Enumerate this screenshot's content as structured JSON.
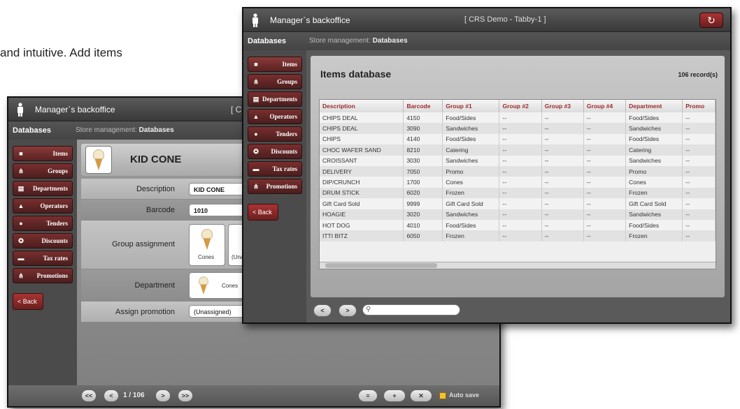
{
  "intro": {
    "text": "and intuitive.  Add items"
  },
  "app": {
    "title": "Manager`s backoffice",
    "section_label": "Databases",
    "breadcrumb_prefix": "Store management:",
    "breadcrumb_current": "Databases"
  },
  "sidebar": {
    "items": [
      {
        "label": "Items",
        "icon": "square-icon"
      },
      {
        "label": "Groups",
        "icon": "groups-icon"
      },
      {
        "label": "Departments",
        "icon": "departments-icon"
      },
      {
        "label": "Operators",
        "icon": "operator-icon"
      },
      {
        "label": "Tenders",
        "icon": "tender-icon"
      },
      {
        "label": "Discounts",
        "icon": "discount-icon"
      },
      {
        "label": "Tax rates",
        "icon": "tax-icon"
      },
      {
        "label": "Promotions",
        "icon": "promotions-icon"
      }
    ],
    "back_label": "< Back"
  },
  "back_window": {
    "title_clip": "[ C",
    "item_name": "KID CONE",
    "form": {
      "description_label": "Description",
      "description_value": "KID CONE",
      "barcode_label": "Barcode",
      "barcode_value": "1010",
      "group_label": "Group assignment",
      "group_card_1": "Cones",
      "group_card_2": "(Unass",
      "department_label": "Department",
      "department_value": "Cones",
      "promotion_label": "Assign promotion",
      "promotion_value": "(Unassigned)"
    },
    "pager": {
      "first": "<<",
      "prev": "<",
      "status": "1 / 106",
      "next": ">",
      "last": ">>",
      "menu": "≡",
      "add": "+",
      "delete": "✕",
      "autosave_label": "Auto save"
    }
  },
  "front_window": {
    "session": "[ CRS Demo  -  Tabby-1 ]",
    "reload_icon": "↻",
    "panel_title": "Items database",
    "record_count": "106 record(s)",
    "columns": [
      "Description",
      "Barcode",
      "Group #1",
      "Group #2",
      "Group #3",
      "Group #4",
      "Department",
      "Promo"
    ],
    "rows": [
      [
        "CHIPS DEAL",
        "4150",
        "Food/Sides",
        "--",
        "--",
        "--",
        "Food/Sides",
        "--"
      ],
      [
        "CHIPS DEAL",
        "3090",
        "Sandwiches",
        "--",
        "--",
        "--",
        "Sandwiches",
        "--"
      ],
      [
        "CHIPS",
        "4140",
        "Food/Sides",
        "--",
        "--",
        "--",
        "Food/Sides",
        "--"
      ],
      [
        "CHOC WAFER SAND",
        "8210",
        "Catering",
        "--",
        "--",
        "--",
        "Catering",
        "--"
      ],
      [
        "CROISSANT",
        "3030",
        "Sandwiches",
        "--",
        "--",
        "--",
        "Sandwiches",
        "--"
      ],
      [
        "DELIVERY",
        "7050",
        "Promo",
        "--",
        "--",
        "--",
        "Promo",
        "--"
      ],
      [
        "DIP/CRUNCH",
        "1700",
        "Cones",
        "--",
        "--",
        "--",
        "Cones",
        "--"
      ],
      [
        "DRUM STICK",
        "6020",
        "Frozen",
        "--",
        "--",
        "--",
        "Frozen",
        "--"
      ],
      [
        "Gift Card Sold",
        "9999",
        "Gift Card Sold",
        "--",
        "--",
        "--",
        "Gift Card Sold",
        "--"
      ],
      [
        "HOAGIE",
        "3020",
        "Sandwiches",
        "--",
        "--",
        "--",
        "Sandwiches",
        "--"
      ],
      [
        "HOT DOG",
        "4010",
        "Food/Sides",
        "--",
        "--",
        "--",
        "Food/Sides",
        "--"
      ],
      [
        "ITTI BITZ",
        "6050",
        "Frozen",
        "--",
        "--",
        "--",
        "Frozen",
        "--"
      ]
    ],
    "nav": {
      "prev": "<",
      "next": ">",
      "search_placeholder": ""
    }
  }
}
